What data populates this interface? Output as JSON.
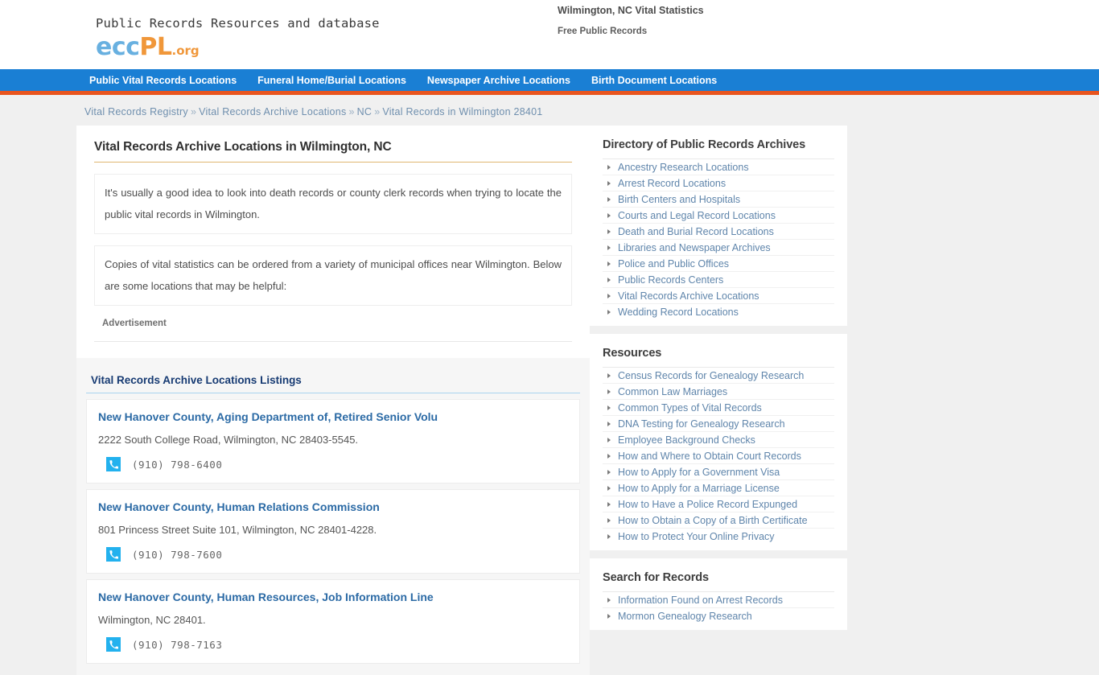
{
  "header": {
    "tagline": "Public Records Resources and database",
    "logo": {
      "part1": "ecc",
      "part2": "PL",
      "part3": ".org"
    },
    "right_line1": "Wilmington, NC Vital Statistics",
    "right_line2": "Free Public Records"
  },
  "nav": {
    "items": [
      {
        "label": "Public Vital Records Locations"
      },
      {
        "label": "Funeral Home/Burial Locations"
      },
      {
        "label": "Newspaper Archive Locations"
      },
      {
        "label": "Birth Document Locations"
      }
    ]
  },
  "breadcrumb": {
    "sep": "»",
    "items": [
      {
        "label": "Vital Records Registry"
      },
      {
        "label": "Vital Records Archive Locations"
      },
      {
        "label": "NC"
      },
      {
        "label": "Vital Records in Wilmington 28401"
      }
    ]
  },
  "main": {
    "title": "Vital Records Archive Locations in Wilmington, NC",
    "paragraph1": "It's usually a good idea to look into death records or county clerk records when trying to locate the public vital records in Wilmington.",
    "paragraph2": "Copies of vital statistics can be ordered from a variety of municipal offices near Wilmington. Below are some locations that may be helpful:",
    "advertisement_label": "Advertisement",
    "listings_title": "Vital Records Archive Locations Listings",
    "listings": [
      {
        "name": "New Hanover County, Aging Department of, Retired Senior Volu",
        "address": "2222 South College Road, Wilmington, NC 28403-5545.",
        "phone": "(910) 798-6400"
      },
      {
        "name": "New Hanover County, Human Relations Commission",
        "address": "801 Princess Street Suite 101, Wilmington, NC 28401-4228.",
        "phone": "(910) 798-7600"
      },
      {
        "name": "New Hanover County, Human Resources, Job Information Line",
        "address": "Wilmington, NC 28401.",
        "phone": "(910) 798-7163"
      }
    ]
  },
  "sidebar": {
    "panels": [
      {
        "title": "Directory of Public Records Archives",
        "items": [
          {
            "label": "Ancestry Research Locations"
          },
          {
            "label": "Arrest Record Locations"
          },
          {
            "label": "Birth Centers and Hospitals"
          },
          {
            "label": "Courts and Legal Record Locations"
          },
          {
            "label": "Death and Burial Record Locations"
          },
          {
            "label": "Libraries and Newspaper Archives"
          },
          {
            "label": "Police and Public Offices"
          },
          {
            "label": "Public Records Centers"
          },
          {
            "label": "Vital Records Archive Locations"
          },
          {
            "label": "Wedding Record Locations"
          }
        ]
      },
      {
        "title": "Resources",
        "items": [
          {
            "label": "Census Records for Genealogy Research"
          },
          {
            "label": "Common Law Marriages"
          },
          {
            "label": "Common Types of Vital Records"
          },
          {
            "label": "DNA Testing for Genealogy Research"
          },
          {
            "label": "Employee Background Checks"
          },
          {
            "label": "How and Where to Obtain Court Records"
          },
          {
            "label": "How to Apply for a Government Visa"
          },
          {
            "label": "How to Apply for a Marriage License"
          },
          {
            "label": "How to Have a Police Record Expunged"
          },
          {
            "label": "How to Obtain a Copy of a Birth Certificate"
          },
          {
            "label": "How to Protect Your Online Privacy"
          }
        ]
      },
      {
        "title": "Search for Records",
        "items": [
          {
            "label": "Information Found on Arrest Records"
          },
          {
            "label": "Mormon Genealogy Research"
          }
        ]
      }
    ]
  },
  "colors": {
    "nav_blue": "#1a7fd4",
    "nav_accent_orange": "#e8541e",
    "logo_blue": "#68b0e0",
    "logo_orange": "#f0973a",
    "link_blue": "#2b6aa5",
    "phone_badge": "#22b1ee",
    "title_underline": "#e0b772"
  },
  "icons": {
    "phone": "phone-icon",
    "bullet": "triangle-right-icon"
  }
}
